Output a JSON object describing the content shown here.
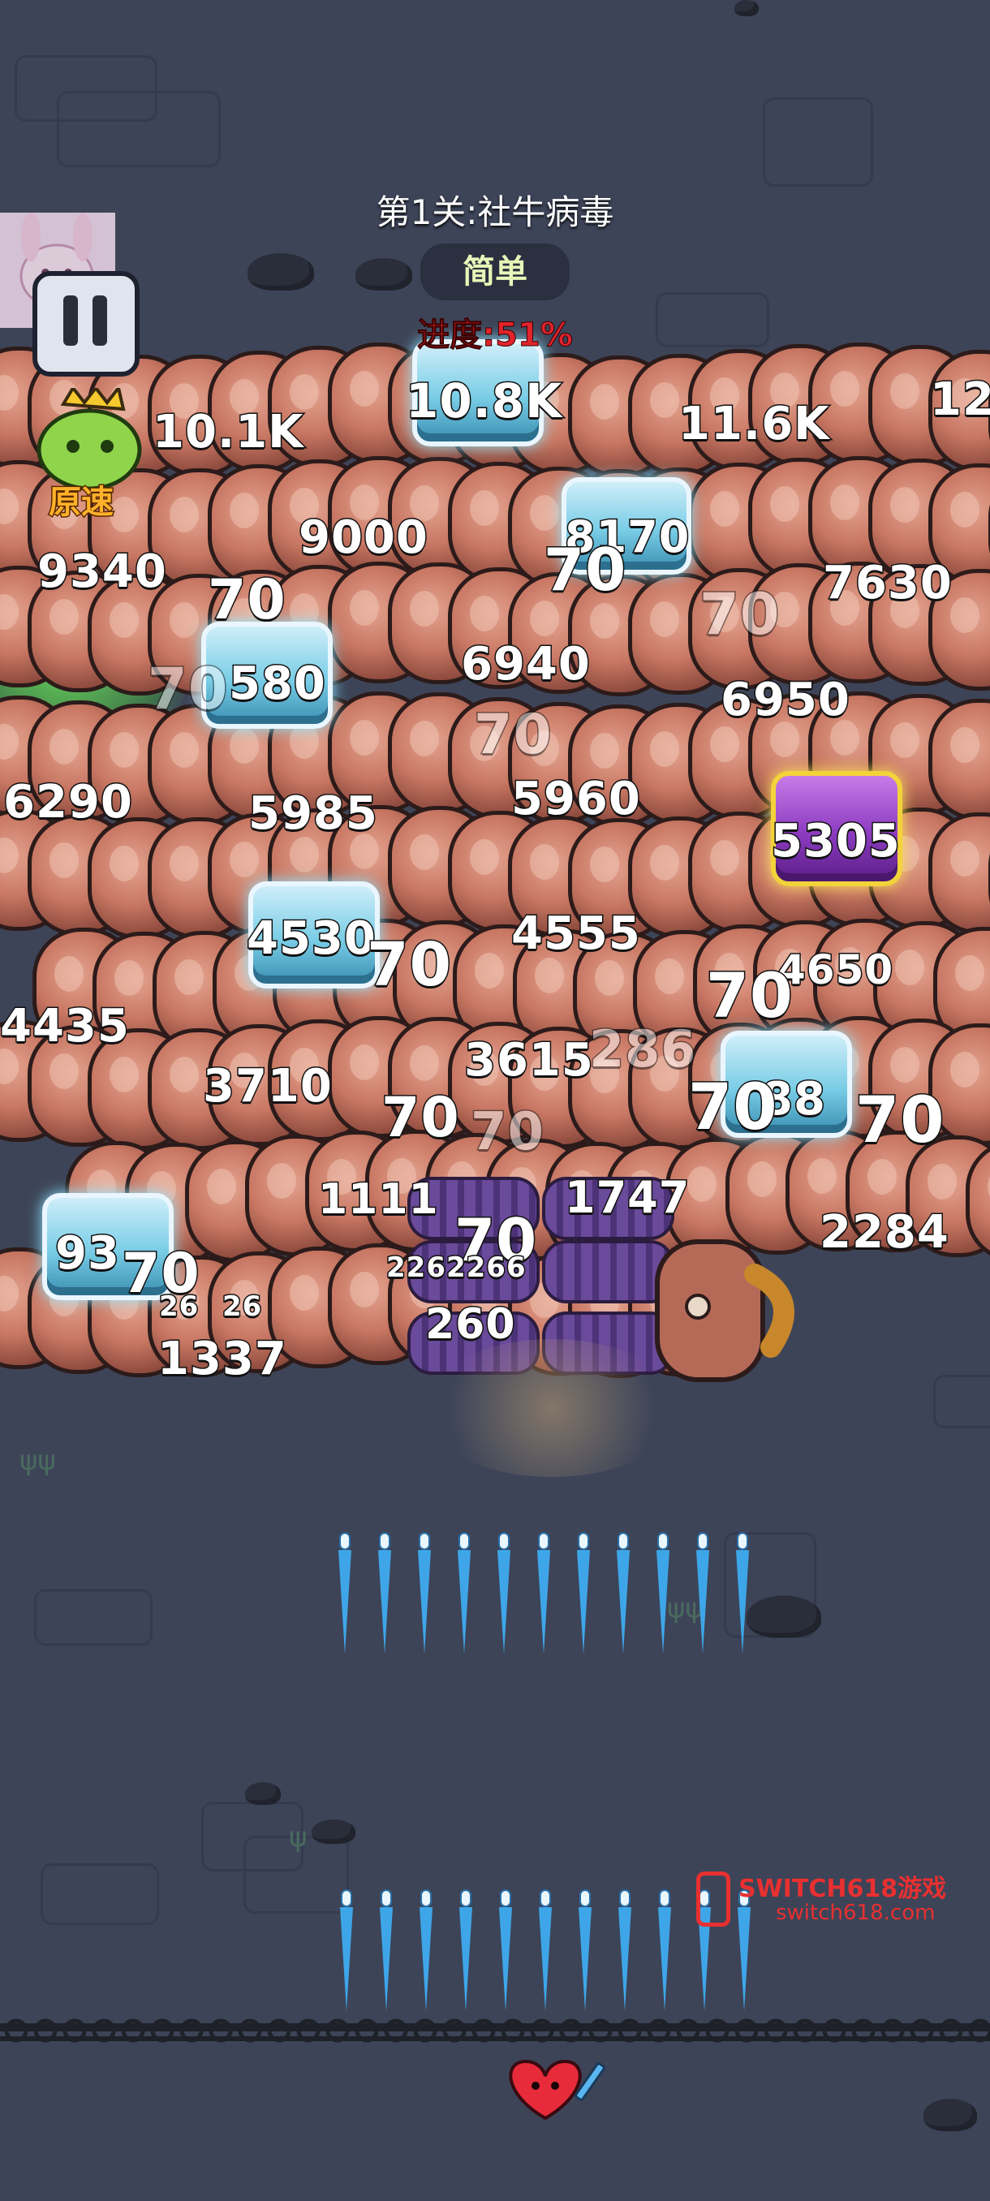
{
  "level": {
    "title": "第1关:社牛病毒",
    "difficulty": "简单",
    "progress_label": "进度:51%"
  },
  "speed_button": {
    "label": "原速"
  },
  "pause_button": {
    "icon": "pause-icon"
  },
  "damage_numbers": [
    "10.1K",
    "10.8K",
    "11.6K",
    "12.",
    "9000",
    "9340",
    "70",
    "8170",
    "70",
    "7630",
    "70",
    "6940",
    "70",
    "580",
    "6950",
    "70",
    "6290",
    "5985",
    "5960",
    "5305",
    "4530",
    "70",
    "4555",
    "4650",
    "70",
    "4435",
    "3710",
    "3615",
    "286",
    "70",
    "88",
    "70",
    "70",
    "70",
    "1111",
    "1747",
    "2284",
    "93",
    "70",
    "70",
    "2262266",
    "26",
    "26",
    "260",
    "1337"
  ],
  "watermark": {
    "brand": "SWITCH618游戏",
    "url": "switch618.com"
  },
  "colors": {
    "background": "#3d4458",
    "worm": "#c87763",
    "bullet": "#3ea6e8",
    "progress_text": "#e0242c",
    "watermark": "#e83030"
  }
}
